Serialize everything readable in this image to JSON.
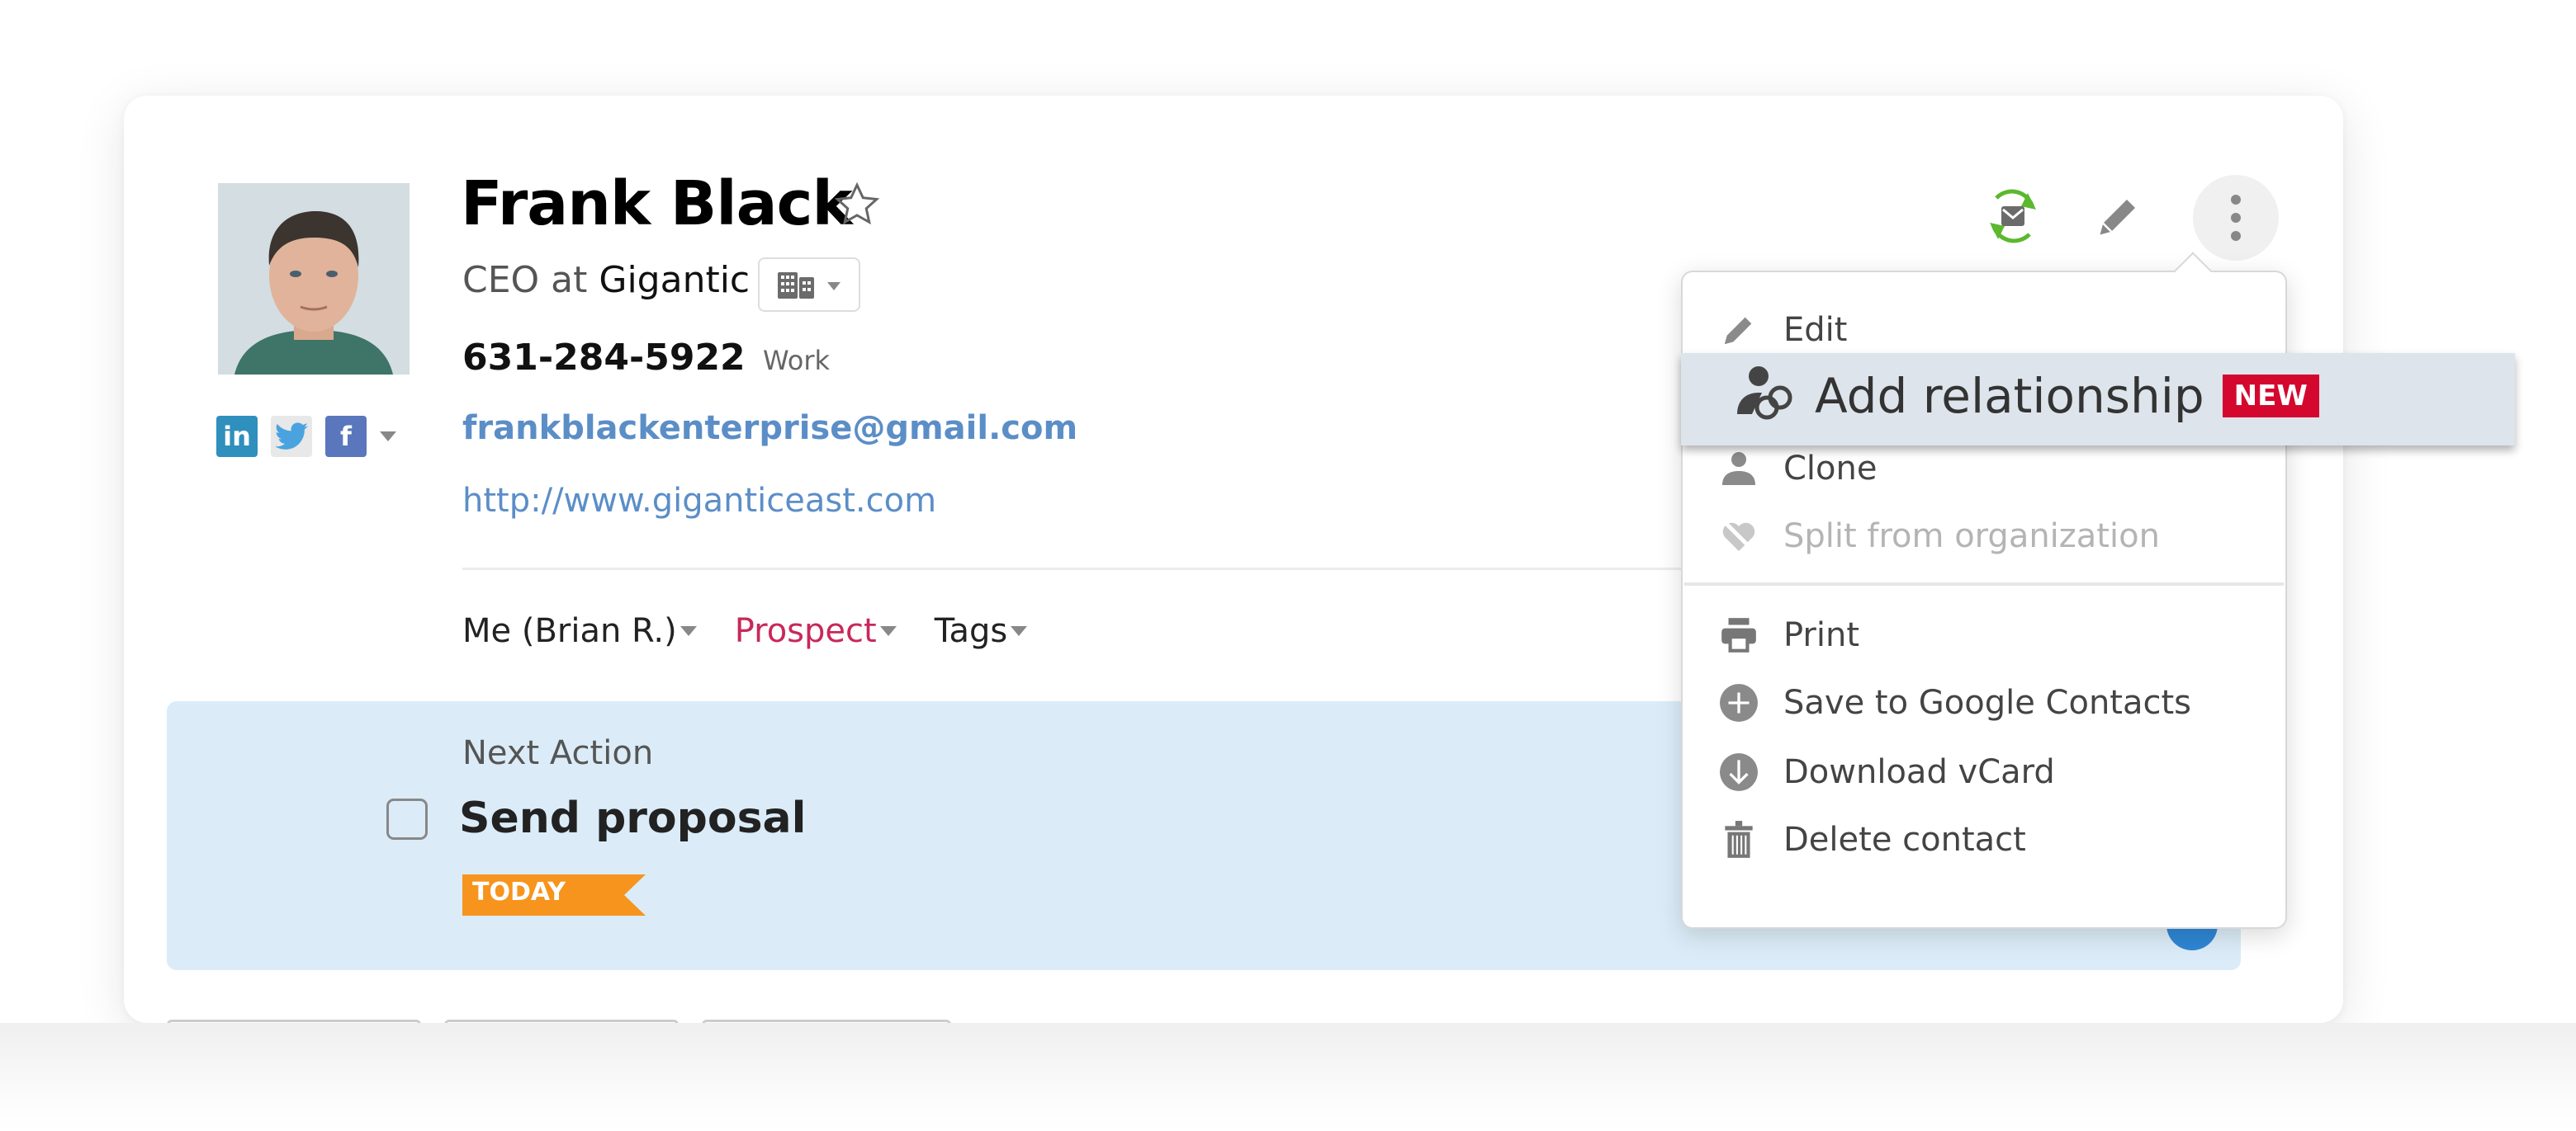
{
  "contact": {
    "name": "Frank Black",
    "title_prefix": "CEO at",
    "organization": "Gigantic",
    "phone": "631-284-5922",
    "phone_type": "Work",
    "email": "frankblackenterprise@gmail.com",
    "website": "http://www.giganticeast.com",
    "social": {
      "linkedin": "in",
      "twitter": "t",
      "facebook": "f"
    }
  },
  "meta": {
    "owner": "Me (Brian R.)",
    "status": "Prospect",
    "tags": "Tags"
  },
  "next_action": {
    "label": "Next Action",
    "task": "Send proposal",
    "due_badge": "TODAY"
  },
  "colors": {
    "link": "#5b8ec7",
    "status_prospect": "#c8285b",
    "today_badge": "#f7941d",
    "new_badge": "#d4082f",
    "next_action_bg": "#dbecf8",
    "sync_green": "#5cb82e"
  },
  "menu": {
    "items": [
      {
        "label": "Edit",
        "icon": "pencil-icon"
      },
      {
        "label": "Add relationship",
        "icon": "relationship-icon",
        "badge": "NEW",
        "highlighted": true
      },
      {
        "label": "Clone",
        "icon": "person-icon"
      },
      {
        "label": "Split from organization",
        "icon": "broken-heart-icon",
        "disabled": true
      },
      {
        "label": "Print",
        "icon": "printer-icon"
      },
      {
        "label": "Save to Google Contacts",
        "icon": "plus-circle-icon"
      },
      {
        "label": "Download vCard",
        "icon": "download-circle-icon"
      },
      {
        "label": "Delete contact",
        "icon": "trash-icon"
      }
    ]
  }
}
